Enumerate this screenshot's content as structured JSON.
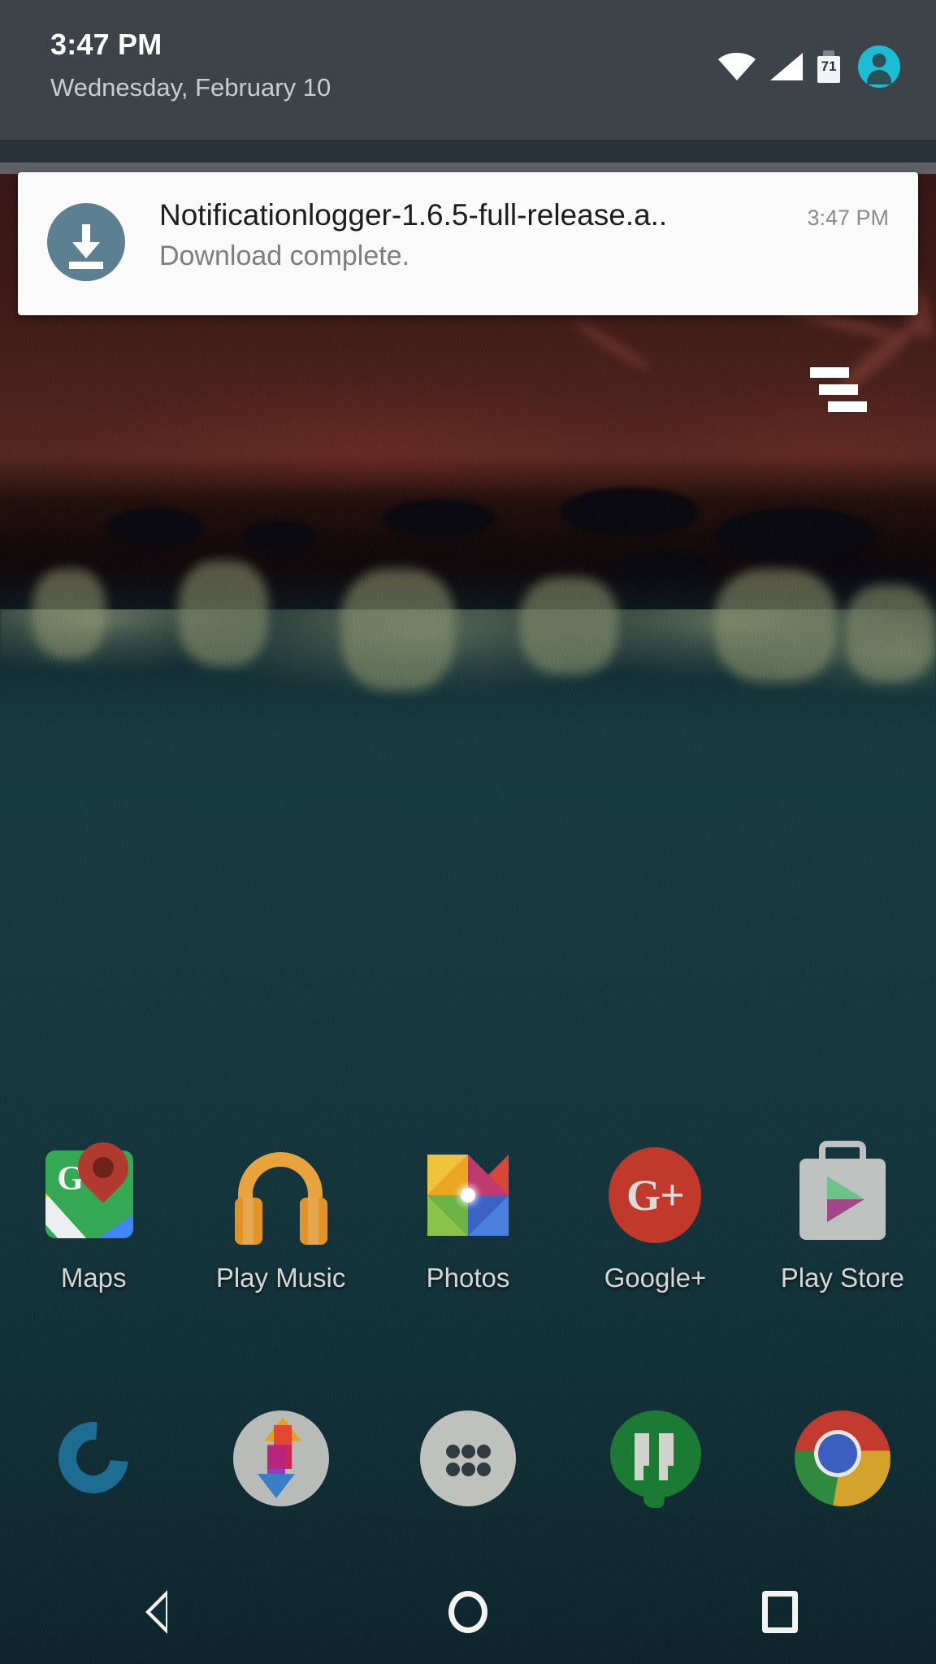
{
  "status_bar": {
    "time": "3:47 PM",
    "date": "Wednesday, February 10",
    "battery_level": "71",
    "icons": [
      "wifi-icon",
      "cellular-signal-icon",
      "battery-icon",
      "user-avatar-icon"
    ],
    "background_color": "#3d4349"
  },
  "notification": {
    "title": "Notificationlogger-1.6.5-full-release.a..",
    "body": "Download complete.",
    "time": "3:47 PM",
    "icon": "download-icon",
    "icon_color": "#5d7f92",
    "card_background": "#fafafa"
  },
  "overlay": {
    "bars_icon": "staggered-bars-icon"
  },
  "home_screen": {
    "apps": [
      {
        "label": "Maps",
        "icon": "google-maps-icon"
      },
      {
        "label": "Play Music",
        "icon": "play-music-icon"
      },
      {
        "label": "Photos",
        "icon": "google-photos-icon"
      },
      {
        "label": "Google+",
        "icon": "google-plus-icon"
      },
      {
        "label": "Play Store",
        "icon": "play-store-icon"
      }
    ],
    "dock": [
      {
        "label": "Phone",
        "icon": "phone-icon"
      },
      {
        "label": "Transfer",
        "icon": "transfer-arrows-icon"
      },
      {
        "label": "App Drawer",
        "icon": "app-drawer-icon"
      },
      {
        "label": "Hangouts",
        "icon": "hangouts-icon"
      },
      {
        "label": "Chrome",
        "icon": "chrome-icon"
      }
    ]
  },
  "nav_bar": {
    "back": "back-button",
    "home": "home-button",
    "recents": "recents-button"
  },
  "wallpaper": {
    "name": "aerial-satellite-wallpaper",
    "colors": {
      "top": "#4a1f1b",
      "shore": "#140a0c",
      "sand": "#c6cb9a",
      "water": "#1b454c"
    }
  }
}
